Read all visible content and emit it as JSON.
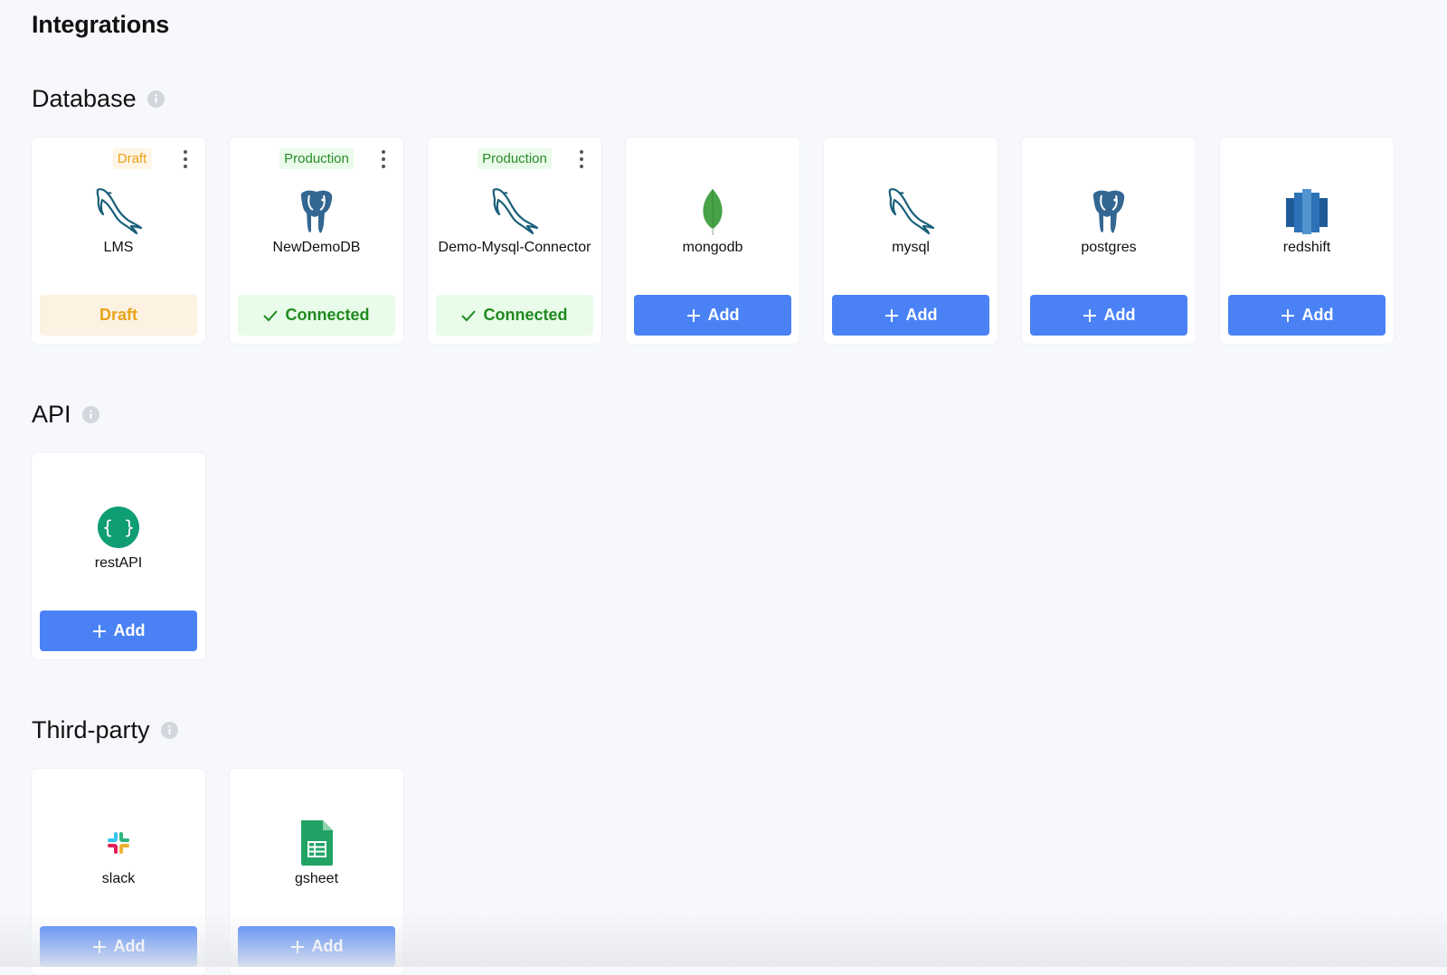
{
  "page": {
    "title": "Integrations"
  },
  "sections": {
    "database": {
      "title": "Database",
      "cards": [
        {
          "name": "LMS",
          "icon": "mysql-dolphin-icon",
          "tag": "Draft",
          "tag_type": "draft",
          "button": "Draft",
          "button_type": "draft"
        },
        {
          "name": "NewDemoDB",
          "icon": "postgres-elephant-icon",
          "tag": "Production",
          "tag_type": "production",
          "button": "Connected",
          "button_type": "connected"
        },
        {
          "name": "Demo-Mysql-Connector",
          "icon": "mysql-dolphin-icon",
          "tag": "Production",
          "tag_type": "production",
          "button": "Connected",
          "button_type": "connected"
        },
        {
          "name": "mongodb",
          "icon": "mongodb-leaf-icon",
          "button": "Add",
          "button_type": "add"
        },
        {
          "name": "mysql",
          "icon": "mysql-dolphin-icon",
          "button": "Add",
          "button_type": "add"
        },
        {
          "name": "postgres",
          "icon": "postgres-elephant-icon",
          "button": "Add",
          "button_type": "add"
        },
        {
          "name": "redshift",
          "icon": "redshift-icon",
          "button": "Add",
          "button_type": "add"
        }
      ]
    },
    "api": {
      "title": "API",
      "cards": [
        {
          "name": "restAPI",
          "icon": "rest-api-braces-icon",
          "button": "Add",
          "button_type": "add"
        }
      ]
    },
    "third_party": {
      "title": "Third-party",
      "cards": [
        {
          "name": "slack",
          "icon": "slack-icon",
          "button": "Add",
          "button_type": "add"
        },
        {
          "name": "gsheet",
          "icon": "google-sheets-icon",
          "button": "Add",
          "button_type": "add"
        }
      ]
    }
  },
  "colors": {
    "primary": "#4a82f5",
    "connected_text": "#1f8a1f",
    "draft_text": "#e8a317",
    "background": "#f6f8fc"
  }
}
